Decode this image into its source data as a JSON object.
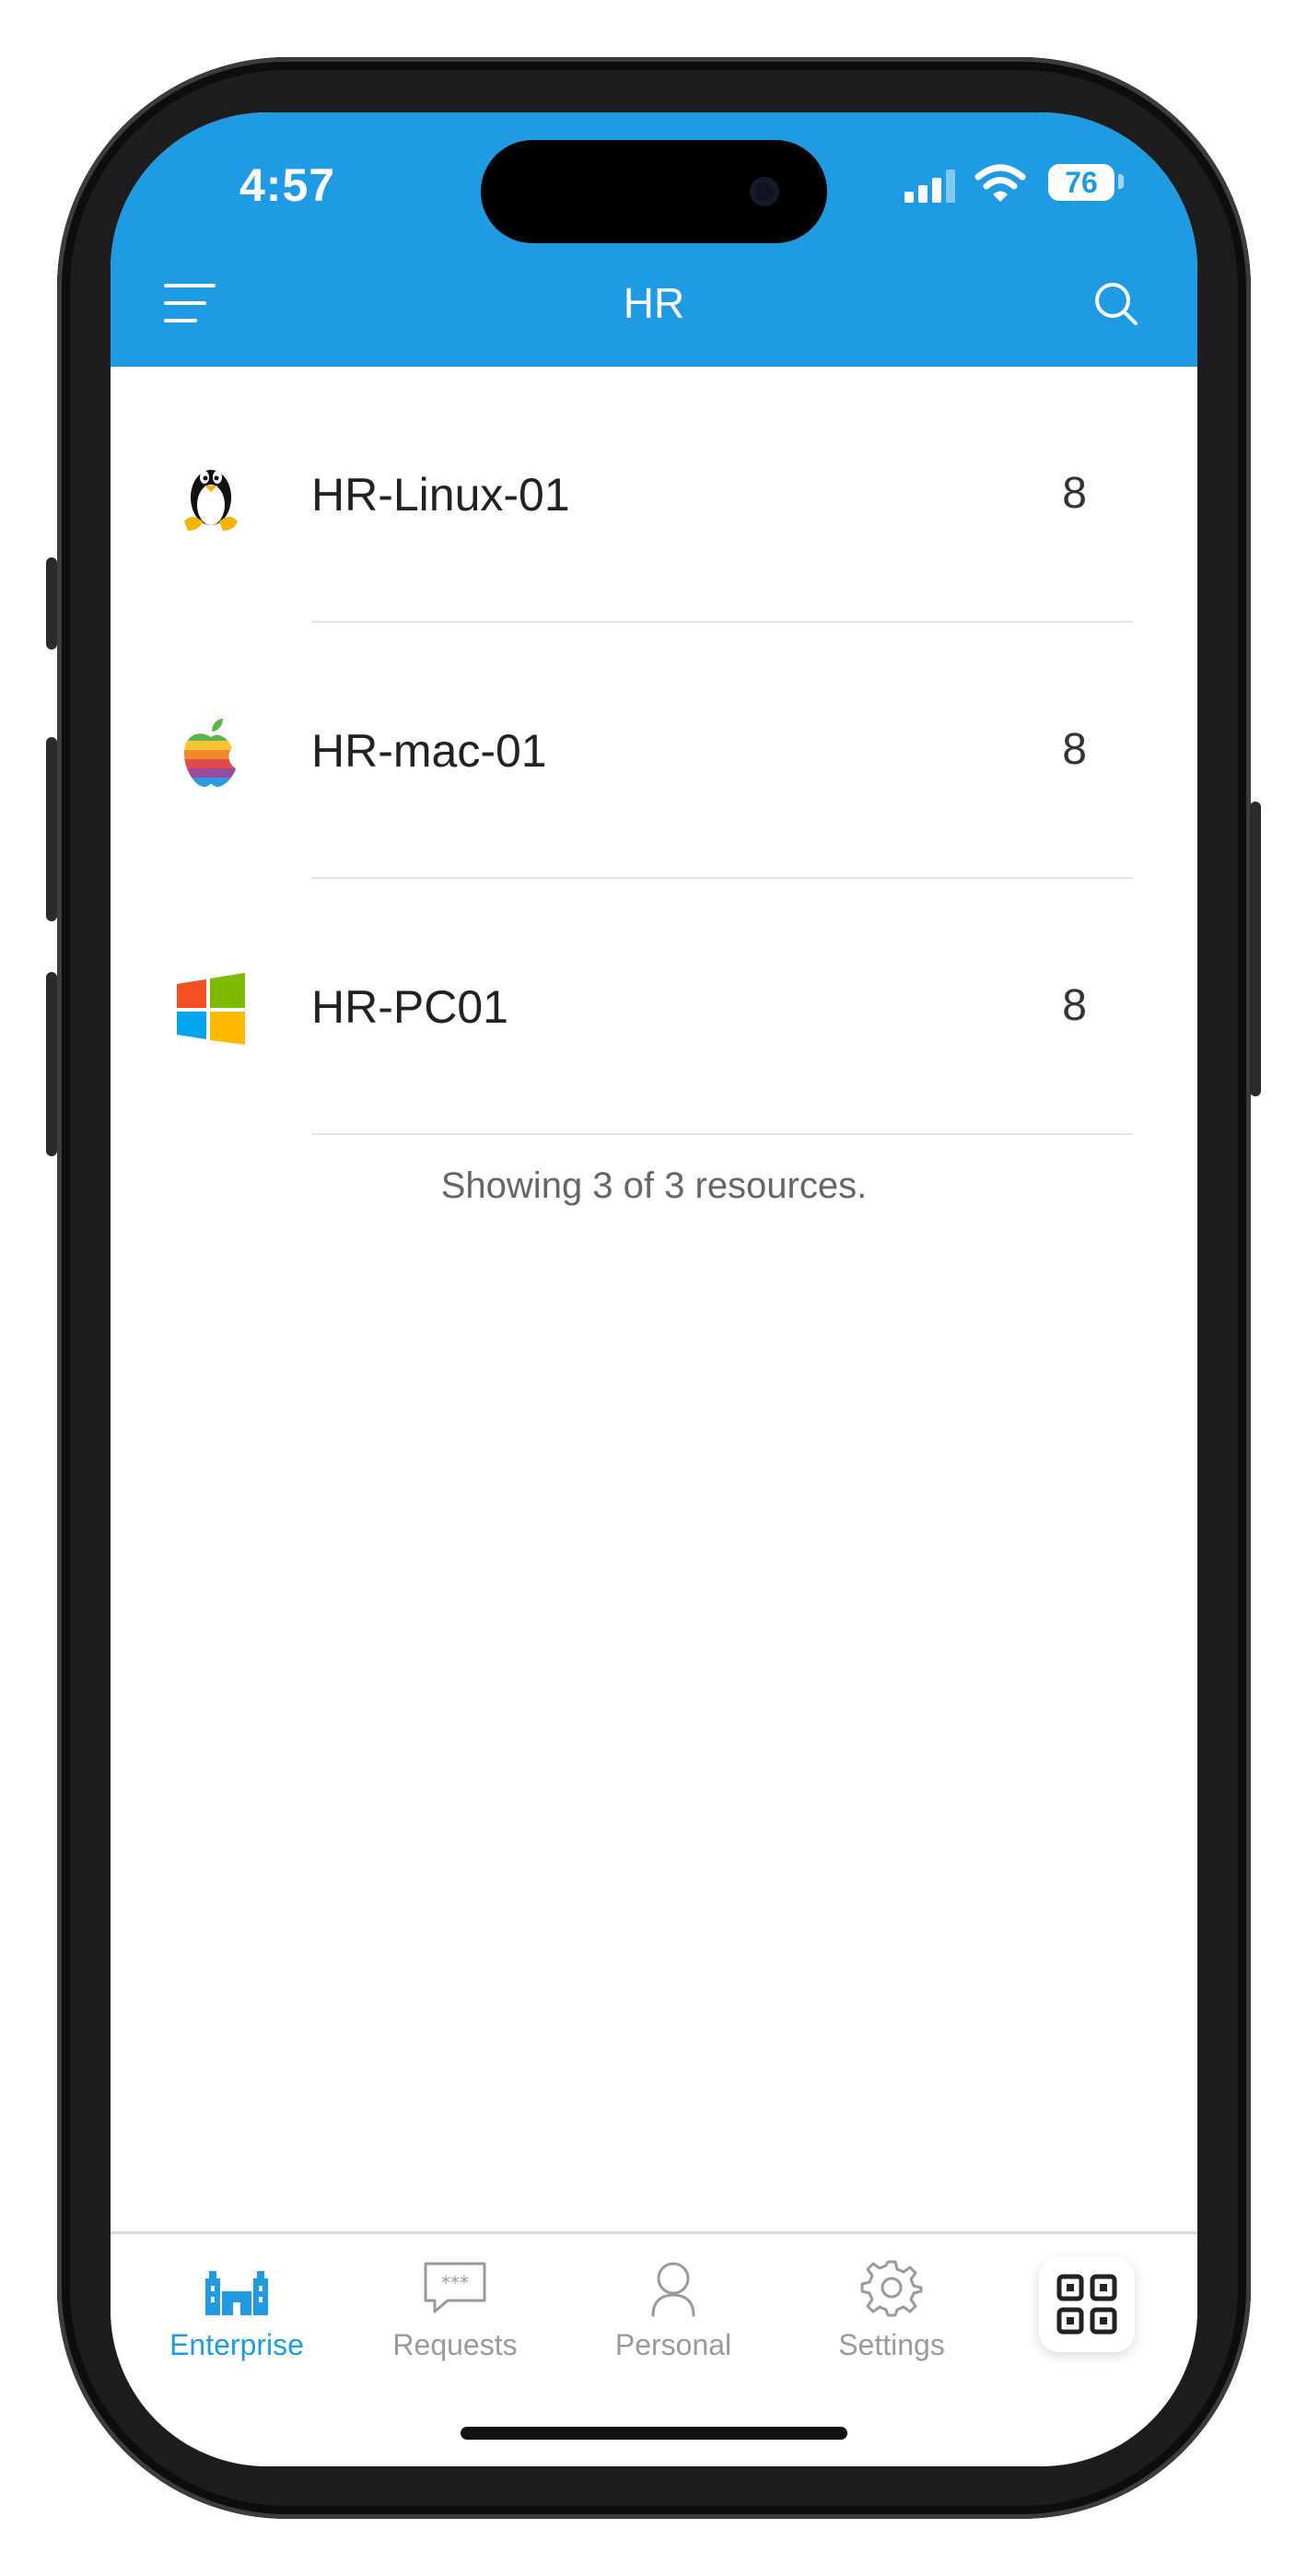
{
  "status": {
    "time": "4:57",
    "battery": "76"
  },
  "header": {
    "title": "HR"
  },
  "resources": [
    {
      "name": "HR-Linux-01",
      "count": "8",
      "os": "linux"
    },
    {
      "name": "HR-mac-01",
      "count": "8",
      "os": "mac"
    },
    {
      "name": "HR-PC01",
      "count": "8",
      "os": "windows"
    }
  ],
  "footer": {
    "summary": "Showing 3 of 3 resources."
  },
  "tabs": [
    {
      "label": "Enterprise",
      "icon": "enterprise-icon",
      "active": true
    },
    {
      "label": "Requests",
      "icon": "requests-icon",
      "active": false
    },
    {
      "label": "Personal",
      "icon": "personal-icon",
      "active": false
    },
    {
      "label": "Settings",
      "icon": "settings-icon",
      "active": false
    }
  ],
  "colors": {
    "accent": "#1e9be3",
    "inactive": "#9a9a9a"
  }
}
